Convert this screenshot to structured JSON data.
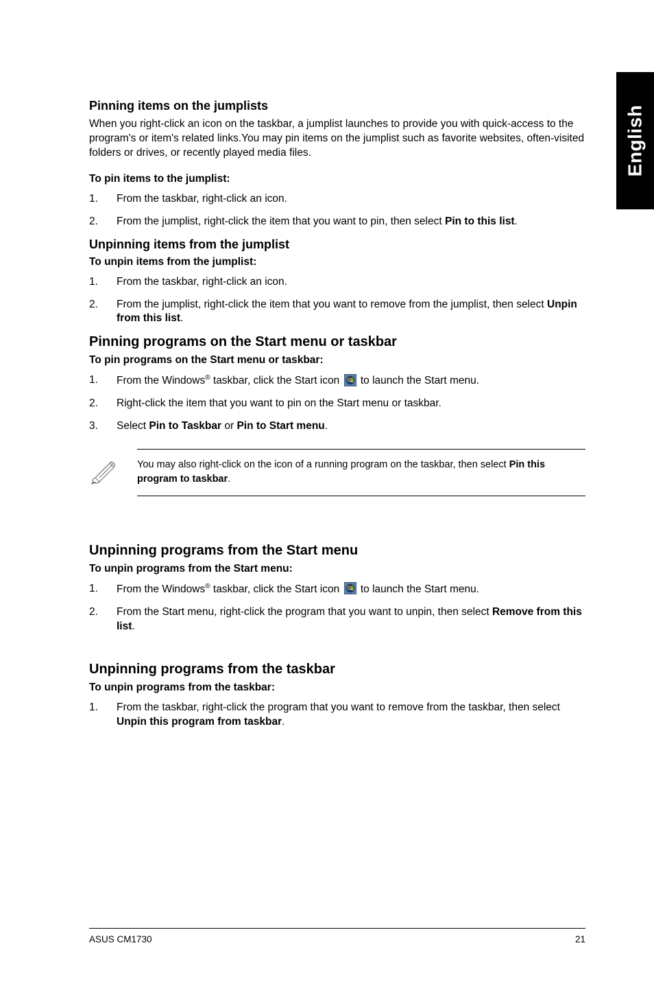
{
  "side_tab": "English",
  "s1": {
    "heading": "Pinning items on the jumplists",
    "intro": "When you right-click an icon on the taskbar, a jumplist launches to provide you with quick-access to the program's or item's related links.You may pin items on the jumplist such as favorite websites, often-visited folders or drives, or recently played media files.",
    "sub": "To pin items to the jumplist:",
    "i1": "From the taskbar, right-click an icon.",
    "i2_pre": "From the jumplist, right-click the item that you want to pin, then select ",
    "i2_bold": "Pin to this list",
    "i2_post": "."
  },
  "s2": {
    "heading": "Unpinning items from the jumplist",
    "sub": "To unpin items from the jumplist:",
    "i1": "From the taskbar, right-click an icon.",
    "i2_pre": "From the jumplist, right-click the item that you want to remove from the jumplist, then select ",
    "i2_bold": "Unpin from this list",
    "i2_post": "."
  },
  "s3": {
    "heading": "Pinning programs on the Start menu or taskbar",
    "sub": "To pin programs on the Start menu or taskbar:",
    "i1_pre": "From the Windows",
    "i1_reg": "®",
    "i1_mid": " taskbar, click the Start icon ",
    "i1_post": " to launch the Start menu.",
    "i2": "Right-click the item that you want to pin on the Start menu or taskbar.",
    "i3_pre": "Select ",
    "i3_b1": "Pin to Taskbar",
    "i3_mid": " or ",
    "i3_b2": "Pin to Start menu",
    "i3_post": "."
  },
  "note": {
    "pre": "You may also right-click on the icon of a running program on the taskbar, then select ",
    "b": "Pin this program to taskbar",
    "post": "."
  },
  "s4": {
    "heading": "Unpinning programs from the Start menu",
    "sub": "To unpin programs from the Start menu:",
    "i1_pre": "From the Windows",
    "i1_reg": "®",
    "i1_mid": " taskbar, click the Start icon ",
    "i1_post": " to launch the Start menu.",
    "i2_pre": "From the Start menu, right-click the program that you want to unpin, then select ",
    "i2_bold": "Remove from this list",
    "i2_post": "."
  },
  "s5": {
    "heading": "Unpinning programs from the taskbar",
    "sub": "To unpin programs from the taskbar:",
    "i1_pre": "From the taskbar, right-click the program that you want to remove from the taskbar, then select ",
    "i1_bold": "Unpin this program from taskbar",
    "i1_post": "."
  },
  "footer": {
    "left": "ASUS CM1730",
    "right": "21"
  },
  "nums": {
    "n1": "1.",
    "n2": "2.",
    "n3": "3."
  }
}
